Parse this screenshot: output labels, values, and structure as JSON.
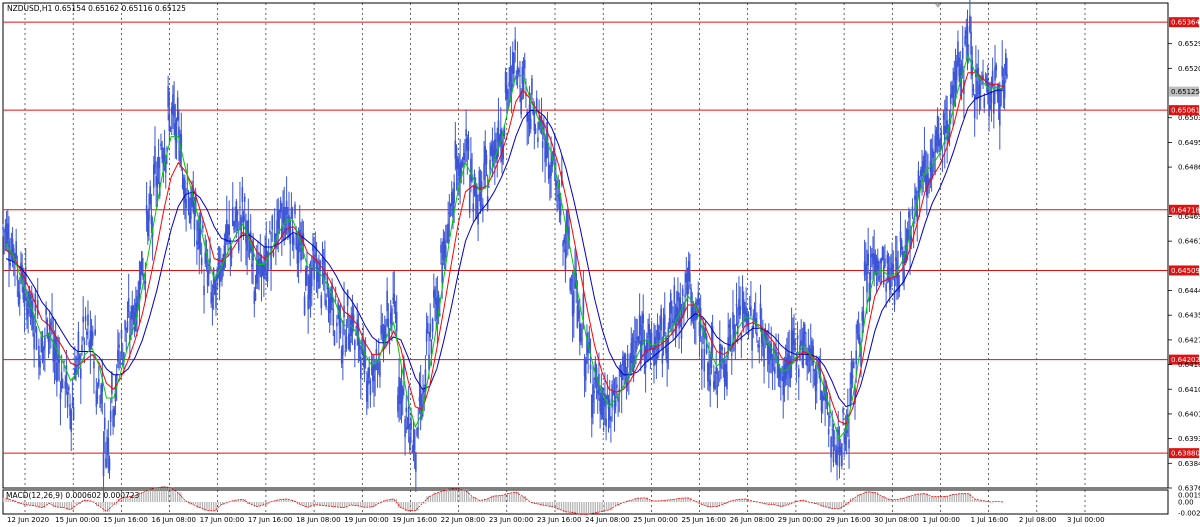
{
  "header": {
    "symbol_line": "NZDUSD,H1  0.65154 0.65162 0.65116 0.65125"
  },
  "macd_header": {
    "label": "MACD(12,26,9) 0.000602 0.000723"
  },
  "colors": {
    "background": "#ffffff",
    "candle": "#3b55d6",
    "level_line": "#e01010",
    "level_tag_bg": "#e01010",
    "ma_fast": "#00cc00",
    "ma_mid": "#ff0000",
    "ma_slow": "#0000cc",
    "grid": "#000000",
    "macd_hist": "#a0a0a0",
    "macd_signal": "#ff0000",
    "price_tag_bg": "#bfbfbf"
  },
  "chart_data": {
    "type": "candlestick",
    "symbol": "NZDUSD",
    "timeframe": "H1",
    "ylim": [
      0.6376,
      0.6543
    ],
    "ytick_labels": [
      "0.65290",
      "0.65205",
      "0.65035",
      "0.64950",
      "0.64865",
      "0.64695",
      "0.64610",
      "0.64440",
      "0.64355",
      "0.64270",
      "0.64185",
      "0.64100",
      "0.64015",
      "0.63930",
      "0.63845",
      "0.63760"
    ],
    "ytick_values": [
      0.6529,
      0.65205,
      0.65035,
      0.6495,
      0.64865,
      0.64695,
      0.6461,
      0.6444,
      0.64355,
      0.6427,
      0.64185,
      0.641,
      0.64015,
      0.6393,
      0.63845,
      0.6376
    ],
    "current_price": {
      "label": "0.65125",
      "value": 0.65125
    },
    "levels": [
      {
        "label": "0.65364",
        "value": 0.65364
      },
      {
        "label": "0.65061",
        "value": 0.65061
      },
      {
        "label": "0.64718",
        "value": 0.64718
      },
      {
        "label": "0.64509",
        "value": 0.64509
      },
      {
        "label": "0.64202",
        "value": 0.64202
      },
      {
        "label": "0.63880",
        "value": 0.6388
      }
    ],
    "xtick_labels": [
      "12 Jun 2020",
      "15 Jun 00:00",
      "15 Jun 16:00",
      "16 Jun 08:00",
      "17 Jun 00:00",
      "17 Jun 16:00",
      "18 Jun 08:00",
      "19 Jun 00:00",
      "19 Jun 16:00",
      "22 Jun 08:00",
      "23 Jun 00:00",
      "23 Jun 16:00",
      "24 Jun 08:00",
      "25 Jun 00:00",
      "25 Jun 16:00",
      "26 Jun 08:00",
      "29 Jun 00:00",
      "29 Jun 16:00",
      "30 Jun 08:00",
      "1 Jul 00:00",
      "1 Jul 16:00",
      "2 Jul 08:00",
      "3 Jul 00:00"
    ],
    "closes": [
      0.6465,
      0.6458,
      0.6448,
      0.6441,
      0.6435,
      0.6425,
      0.6433,
      0.642,
      0.6414,
      0.6405,
      0.6418,
      0.6428,
      0.6425,
      0.641,
      0.6392,
      0.6408,
      0.6424,
      0.6431,
      0.6438,
      0.6452,
      0.6468,
      0.6482,
      0.6495,
      0.6503,
      0.6497,
      0.648,
      0.6472,
      0.6461,
      0.645,
      0.6442,
      0.6455,
      0.6461,
      0.6466,
      0.647,
      0.6458,
      0.6449,
      0.6452,
      0.646,
      0.6466,
      0.647,
      0.6468,
      0.6457,
      0.6447,
      0.6452,
      0.6447,
      0.6442,
      0.6436,
      0.6429,
      0.6433,
      0.6427,
      0.6418,
      0.6415,
      0.6424,
      0.6431,
      0.6436,
      0.6412,
      0.6398,
      0.6391,
      0.6406,
      0.6426,
      0.6441,
      0.6457,
      0.6472,
      0.6485,
      0.6492,
      0.648,
      0.6475,
      0.6482,
      0.6494,
      0.65,
      0.6512,
      0.6523,
      0.6518,
      0.6506,
      0.6501,
      0.6495,
      0.6488,
      0.6475,
      0.646,
      0.6448,
      0.6432,
      0.642,
      0.6412,
      0.6406,
      0.6402,
      0.6409,
      0.6414,
      0.6419,
      0.6426,
      0.643,
      0.6424,
      0.6426,
      0.643,
      0.6434,
      0.644,
      0.6445,
      0.6438,
      0.6428,
      0.6419,
      0.6416,
      0.6421,
      0.6428,
      0.6434,
      0.6437,
      0.6433,
      0.643,
      0.6424,
      0.6421,
      0.6413,
      0.6417,
      0.6423,
      0.6427,
      0.6421,
      0.6416,
      0.6406,
      0.6396,
      0.6389,
      0.6397,
      0.6414,
      0.6431,
      0.6447,
      0.6455,
      0.6452,
      0.6448,
      0.645,
      0.6457,
      0.6468,
      0.648,
      0.6489,
      0.6488,
      0.6493,
      0.65,
      0.6512,
      0.6522,
      0.6529,
      0.6517,
      0.6515,
      0.6512,
      0.6514,
      0.6513
    ],
    "ma_fast": [
      0.646,
      0.6456,
      0.6449,
      0.6442,
      0.6435,
      0.6428,
      0.6429,
      0.6424,
      0.6419,
      0.6413,
      0.6416,
      0.6422,
      0.6424,
      0.6418,
      0.6407,
      0.6407,
      0.6416,
      0.6425,
      0.6433,
      0.6445,
      0.6459,
      0.6473,
      0.6487,
      0.6497,
      0.6497,
      0.6486,
      0.6477,
      0.6467,
      0.6456,
      0.6448,
      0.6452,
      0.6458,
      0.6463,
      0.6467,
      0.6461,
      0.6453,
      0.6453,
      0.6458,
      0.6464,
      0.6468,
      0.6468,
      0.6461,
      0.6452,
      0.6452,
      0.6449,
      0.6445,
      0.6439,
      0.6432,
      0.6432,
      0.6429,
      0.6422,
      0.6418,
      0.6421,
      0.6428,
      0.6433,
      0.6419,
      0.6406,
      0.6397,
      0.6402,
      0.6417,
      0.6432,
      0.6449,
      0.6465,
      0.6479,
      0.6488,
      0.6483,
      0.6478,
      0.648,
      0.6489,
      0.6496,
      0.6507,
      0.6518,
      0.6518,
      0.651,
      0.6504,
      0.6498,
      0.6491,
      0.648,
      0.6466,
      0.6453,
      0.6438,
      0.6426,
      0.6416,
      0.6409,
      0.6404,
      0.6407,
      0.6411,
      0.6416,
      0.6422,
      0.6427,
      0.6425,
      0.6426,
      0.6428,
      0.6432,
      0.6437,
      0.6442,
      0.6439,
      0.6431,
      0.6423,
      0.6418,
      0.642,
      0.6425,
      0.6431,
      0.6435,
      0.6434,
      0.6431,
      0.6426,
      0.6423,
      0.6416,
      0.6417,
      0.6421,
      0.6425,
      0.6422,
      0.6418,
      0.641,
      0.6401,
      0.6393,
      0.6396,
      0.6408,
      0.6424,
      0.644,
      0.645,
      0.6451,
      0.6449,
      0.645,
      0.6455,
      0.6464,
      0.6475,
      0.6485,
      0.6487,
      0.6491,
      0.6497,
      0.6507,
      0.6517,
      0.6525,
      0.6519,
      0.6516,
      0.6513,
      0.6514,
      0.6513
    ],
    "ma_mid": [
      0.6458,
      0.6456,
      0.6451,
      0.6446,
      0.644,
      0.6434,
      0.6432,
      0.6428,
      0.6424,
      0.6419,
      0.6418,
      0.642,
      0.6422,
      0.6419,
      0.6412,
      0.641,
      0.6414,
      0.642,
      0.6427,
      0.6436,
      0.6447,
      0.6459,
      0.6472,
      0.6483,
      0.6488,
      0.6485,
      0.648,
      0.6472,
      0.6464,
      0.6455,
      0.6454,
      0.6456,
      0.646,
      0.6464,
      0.6462,
      0.6457,
      0.6455,
      0.6457,
      0.6461,
      0.6465,
      0.6466,
      0.6463,
      0.6457,
      0.6455,
      0.6452,
      0.6448,
      0.6443,
      0.6437,
      0.6435,
      0.6432,
      0.6426,
      0.6422,
      0.6422,
      0.6425,
      0.643,
      0.6424,
      0.6413,
      0.6404,
      0.6403,
      0.6411,
      0.6424,
      0.6438,
      0.6453,
      0.6467,
      0.6478,
      0.648,
      0.6479,
      0.648,
      0.6485,
      0.6491,
      0.6499,
      0.6509,
      0.6513,
      0.651,
      0.6506,
      0.6501,
      0.6495,
      0.6487,
      0.6476,
      0.6463,
      0.645,
      0.6437,
      0.6425,
      0.6416,
      0.641,
      0.6409,
      0.641,
      0.6413,
      0.6418,
      0.6423,
      0.6424,
      0.6425,
      0.6427,
      0.643,
      0.6434,
      0.6439,
      0.6439,
      0.6434,
      0.6428,
      0.6423,
      0.6422,
      0.6424,
      0.6428,
      0.6432,
      0.6433,
      0.6432,
      0.6429,
      0.6426,
      0.6421,
      0.6419,
      0.642,
      0.6423,
      0.6422,
      0.642,
      0.6414,
      0.6406,
      0.6399,
      0.6398,
      0.6404,
      0.6416,
      0.643,
      0.6442,
      0.6447,
      0.6448,
      0.6449,
      0.6452,
      0.6459,
      0.6468,
      0.6478,
      0.6483,
      0.6487,
      0.6493,
      0.6501,
      0.6511,
      0.6519,
      0.6519,
      0.6517,
      0.6515,
      0.6515,
      0.6514
    ],
    "ma_slow": [
      0.6455,
      0.6454,
      0.6452,
      0.6449,
      0.6445,
      0.644,
      0.6437,
      0.6433,
      0.6429,
      0.6425,
      0.6423,
      0.6423,
      0.6423,
      0.6421,
      0.6417,
      0.6415,
      0.6415,
      0.6417,
      0.6421,
      0.6427,
      0.6435,
      0.6444,
      0.6455,
      0.6465,
      0.6473,
      0.6477,
      0.6478,
      0.6476,
      0.6472,
      0.6466,
      0.6462,
      0.6461,
      0.6461,
      0.6463,
      0.6463,
      0.6461,
      0.6459,
      0.6459,
      0.646,
      0.6462,
      0.6464,
      0.6463,
      0.6461,
      0.6459,
      0.6456,
      0.6453,
      0.6449,
      0.6444,
      0.6441,
      0.6437,
      0.6432,
      0.6428,
      0.6426,
      0.6426,
      0.6428,
      0.6427,
      0.6421,
      0.6414,
      0.641,
      0.6411,
      0.6417,
      0.6427,
      0.6438,
      0.645,
      0.6461,
      0.6467,
      0.6471,
      0.6474,
      0.6478,
      0.6483,
      0.6489,
      0.6497,
      0.6503,
      0.6506,
      0.6506,
      0.6504,
      0.65,
      0.6494,
      0.6486,
      0.6476,
      0.6465,
      0.6453,
      0.6441,
      0.6431,
      0.6423,
      0.6418,
      0.6415,
      0.6415,
      0.6416,
      0.6419,
      0.6421,
      0.6423,
      0.6425,
      0.6427,
      0.643,
      0.6434,
      0.6436,
      0.6435,
      0.6432,
      0.6428,
      0.6426,
      0.6425,
      0.6427,
      0.6429,
      0.6431,
      0.6431,
      0.643,
      0.6428,
      0.6425,
      0.6423,
      0.6422,
      0.6422,
      0.6422,
      0.6421,
      0.6418,
      0.6413,
      0.6407,
      0.6404,
      0.6405,
      0.6411,
      0.642,
      0.643,
      0.6437,
      0.6441,
      0.6444,
      0.6447,
      0.6452,
      0.6459,
      0.6467,
      0.6474,
      0.6479,
      0.6485,
      0.6492,
      0.65,
      0.6507,
      0.651,
      0.6511,
      0.6512,
      0.6513,
      0.6513
    ],
    "macd": {
      "ylim": [
        -0.0025,
        0.0025
      ],
      "ytick_labels": [
        "0.00195",
        "0.00",
        "-0.00280"
      ],
      "ytick_values": [
        0.00195,
        0.0,
        -0.0028
      ]
    }
  }
}
